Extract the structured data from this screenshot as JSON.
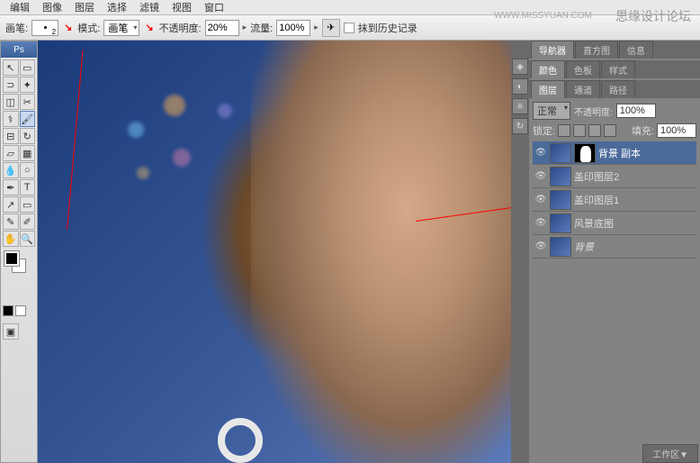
{
  "menu": {
    "items": [
      "编辑",
      "图像",
      "图层",
      "选择",
      "滤镜",
      "视图",
      "窗口"
    ]
  },
  "options": {
    "brush_label": "画笔:",
    "brush_size": "2",
    "mode_label": "模式:",
    "mode_value": "画笔",
    "opacity_label": "不透明度:",
    "opacity_value": "20%",
    "flow_label": "流量:",
    "flow_value": "100%",
    "history_chk": "抹到历史记录"
  },
  "toolbox": {
    "ps": "Ps"
  },
  "panels": {
    "nav": {
      "tabs": [
        "导航器",
        "直方图",
        "信息"
      ]
    },
    "color": {
      "tabs": [
        "颜色",
        "色板",
        "样式"
      ]
    },
    "layers": {
      "tabs": [
        "图层",
        "通道",
        "路径"
      ],
      "blend": "正常",
      "opacity_lbl": "不透明度:",
      "opacity": "100%",
      "lock_lbl": "锁定:",
      "fill_lbl": "填充:",
      "fill": "100%",
      "items": [
        {
          "name": "背景 副本",
          "sel": true,
          "mask": true
        },
        {
          "name": "盖印图层2",
          "sel": false,
          "mask": false
        },
        {
          "name": "盖印图层1",
          "sel": false,
          "mask": false
        },
        {
          "name": "风景底图",
          "sel": false,
          "mask": false
        },
        {
          "name": "背景",
          "sel": false,
          "mask": false,
          "italic": true
        }
      ]
    }
  },
  "watermark": "思缘设计论坛",
  "watermark2": "WWW.MISSYUAN.COM",
  "workspace": "工作区▼"
}
